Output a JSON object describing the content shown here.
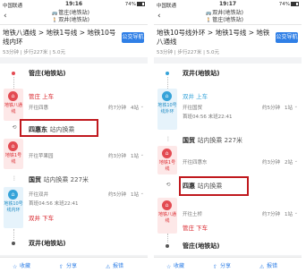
{
  "left": {
    "status": {
      "carrier": "中国联通 ",
      "time": "19:16",
      "battery": "74%"
    },
    "nav": {
      "bus": "管庄(地铁站)",
      "walk": "双井(地铁站)"
    },
    "route": {
      "title": "地铁八通线 > 地铁1号线 > 地铁10号线内环",
      "summary": "53分钟 | 步行227米 | 5.0元",
      "nav_button": "公交导航"
    },
    "start": "管庄(地铁站)",
    "line1": {
      "name": "地铁八通线",
      "label": "地铁八通线",
      "board": "管庄 上车",
      "toward": "开往四惠",
      "time": "约7分钟",
      "stops": "4站"
    },
    "transfer": {
      "station": "四惠东",
      "hint": "站内换乘"
    },
    "line2": {
      "name": "地铁1号线",
      "label": "地铁1号线",
      "toward": "开往苹果园",
      "time": "约3分钟",
      "stops": "1站"
    },
    "walk": {
      "station": "国贸",
      "hint": "站内换乘 227米"
    },
    "line3": {
      "name": "地铁10号线内环",
      "label": "地铁10号线内环",
      "toward": "开往双井",
      "schedule": "首班04:56 末班22:41",
      "time": "约5分钟",
      "stops": "1站",
      "alight": "双井 下车"
    },
    "end": "双井(地铁站)",
    "toolbar": {
      "fav": "收藏",
      "share": "分享",
      "report": "报错"
    }
  },
  "right": {
    "status": {
      "carrier": "中国联通 ",
      "time": "19:17",
      "battery": "74%"
    },
    "nav": {
      "bus": "双井(地铁站)",
      "walk": "管庄(地铁站)"
    },
    "route": {
      "title": "地铁10号线外环 > 地铁1号线 > 地铁八通线",
      "summary": "53分钟 | 步行227米 | 5.0元",
      "nav_button": "公交导航"
    },
    "start": "双井(地铁站)",
    "line1": {
      "name": "地铁10号线外环",
      "label": "地铁10号线外环",
      "board": "双井 上车",
      "toward": "开往国贸",
      "schedule": "首班04:56 末班22:41",
      "time": "约5分钟",
      "stops": "1站"
    },
    "walk": {
      "station": "国贸",
      "hint": "站内换乘 227米"
    },
    "line2": {
      "name": "地铁1号线",
      "label": "地铁1号线",
      "toward": "开往四惠东",
      "time": "约3分钟",
      "stops": "2站"
    },
    "transfer": {
      "station": "四惠",
      "hint": "站内换乘"
    },
    "line3": {
      "name": "地铁八通线",
      "label": "地铁八通线",
      "toward": "开往土桥",
      "time": "约7分钟",
      "stops": "1站",
      "alight": "管庄 下车"
    },
    "end": "管庄(地铁站)",
    "toolbar": {
      "fav": "收藏",
      "share": "分享",
      "report": "报错"
    }
  },
  "colors": {
    "accent": "#2f7fe6",
    "line_red": "#e34b52",
    "line_blue": "#36a3d9",
    "highlight": "#c0191e"
  }
}
